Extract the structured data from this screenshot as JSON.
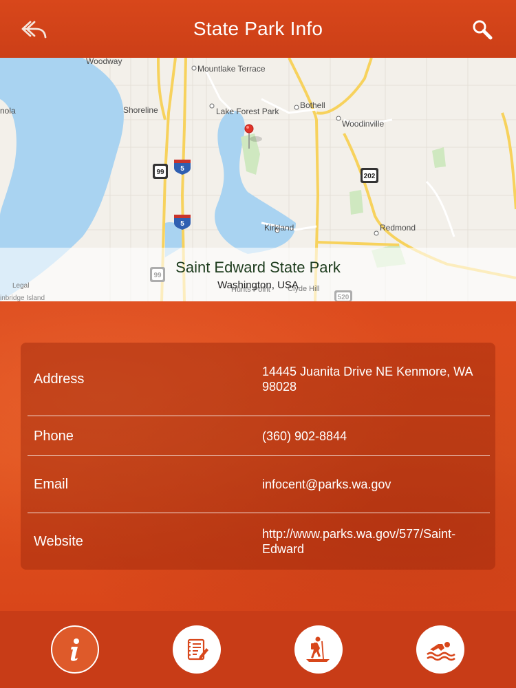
{
  "header": {
    "title": "State Park Info",
    "back_icon": "back-arrow-icon",
    "search_icon": "search-icon"
  },
  "map": {
    "labels": {
      "woodway": "Woodway",
      "mountlake_terrace": "Mountlake Terrace",
      "shoreline": "Shoreline",
      "lake_forest_park": "Lake Forest Park",
      "bothell": "Bothell",
      "woodinville": "Woodinville",
      "kirkland": "Kirkland",
      "redmond": "Redmond",
      "hunts_point": "Hunts Point",
      "clyde_hill": "Clyde Hill",
      "nola": "nola",
      "bainbridge": "inbridge Island"
    },
    "shields": {
      "hwy99_a": "99",
      "i5_a": "5",
      "i5_b": "5",
      "hwy99_b": "99",
      "hwy202": "202",
      "hwy520": "520"
    },
    "park_name": "Saint Edward State Park",
    "park_region": "Washington, USA",
    "legal": "Legal"
  },
  "info": {
    "rows": [
      {
        "label": "Address",
        "value": "14445 Juanita Drive NE Kenmore, WA 98028"
      },
      {
        "label": "Phone",
        "value": "(360) 902-8844"
      },
      {
        "label": "Email",
        "value": "infocent@parks.wa.gov"
      },
      {
        "label": "Website",
        "value": "http://www.parks.wa.gov/577/Saint-Edward"
      }
    ]
  },
  "tabs": [
    {
      "icon": "info-icon",
      "active": true
    },
    {
      "icon": "notes-icon",
      "active": false
    },
    {
      "icon": "hiking-icon",
      "active": false
    },
    {
      "icon": "swimming-icon",
      "active": false
    }
  ],
  "colors": {
    "header": "#d8471b",
    "background": "#d9451b",
    "tabbar": "#c83c17",
    "water": "#a9d3f1",
    "road": "#f7d25d"
  }
}
